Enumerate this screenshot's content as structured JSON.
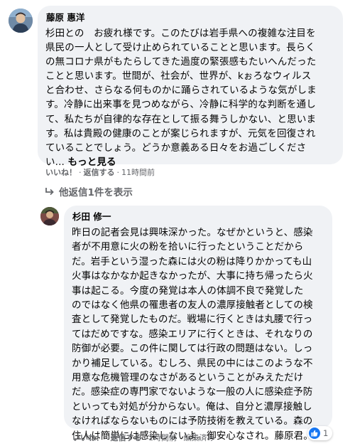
{
  "colors": {
    "bubble_bg": "#f0f2f5",
    "meta_text": "#65676b",
    "like_blue": "#1877f2"
  },
  "comments": [
    {
      "author": "藤原 惠洋",
      "text": "杉田との　お疲れ様です。このたびは岩手県への複雑な注目を\n県民の一人として受け止められていることと思います。長らく\nの無コロナ県がもたらしてきた過度の緊張感もたいへんだった\nことと思います。世間が、社会が、世界が、kぉろなウィルス\nと合わせ、さらなる何ものかに踊らされているような気がしま\nす。冷静に出来事を見つめながら、冷静に科学的な判断を通し\nて、私たちが自律的な存在として振る舞うしかない、と思いま\nす。私は貴殿の健康のことが案じられますが、元気を回復され\nていることでしょう。どうか意義ある日々をお過ごしくださ\nい...",
      "see_more": "もっと見る",
      "avatar_icon": "user-photo",
      "actions": {
        "like": "いいね！",
        "reply": "返信する",
        "time": "11時間前"
      }
    },
    {
      "author": "杉田 修一",
      "text": "昨日の記者会見は興味深かった。なぜかというと、感染\n者が不用意に火の粉を拾いに行ったということだから\nだ。岩手という湿った森には火の粉は降りかかっても山\n火事はなかなか起きなかったが、大事に持ち帰ったら火\n事は起こる。今度の発覚は本人の体調不良で発覚した\nのではなく他県の罹患者の友人の濃厚接触者としての検\n査として発覚したものだ。戦場に行くときは丸腰で行っ\nてはだめですな。感染エリアに行くときは、それなりの\n防御が必要。この件に関しては行政の問題はない。しっ\nかり補足している。むしろ、県民の中にはこのような不\n用意な危機管理のなさがあるということがみえただけ\nだ。感染症の専門家でないような一般の人に感染症予防\nといっても対処が分からない。俺は、自分と濃厚接触し\nなければならないものには予防技術を教えている。森の\n住人は簡単には感染しないよ。御安心なされ。藤原君。",
      "avatar_icon": "user-photo",
      "actions": {
        "like": "いいね！",
        "reply": "返信する",
        "time": "1時間前",
        "edited": "編集済み"
      },
      "reaction_icon": "like-thumb-icon",
      "reaction_count": "1"
    }
  ],
  "view_replies": "他返信1件を表示",
  "separator": "·"
}
